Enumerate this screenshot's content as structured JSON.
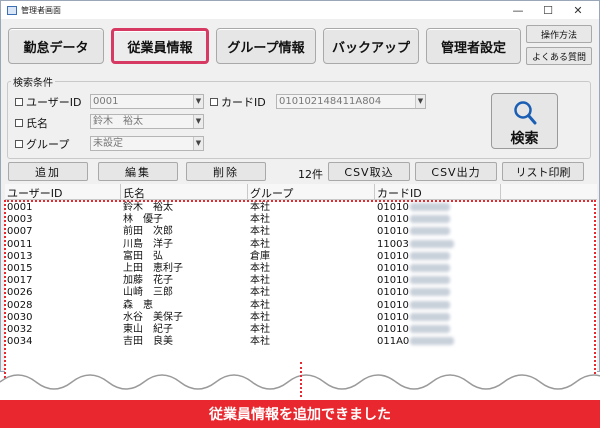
{
  "window": {
    "title": "管理者画面"
  },
  "controls": {
    "minimize": "—",
    "maximize": "☐",
    "close": "✕"
  },
  "nav": {
    "attendance": "勤怠データ",
    "employee": "従業員情報",
    "group": "グループ情報",
    "backup": "バックアップ",
    "admin": "管理者設定",
    "manual": "操作方法",
    "faq": "よくある質問"
  },
  "search": {
    "legend": "検索条件",
    "user_id_label": "ユーザーID",
    "user_id_value": "0001",
    "card_id_label": "カードID",
    "card_id_value": "010102148411A804",
    "name_label": "氏名",
    "name_value": "鈴木　裕太",
    "group_label": "グループ",
    "group_value": "未設定",
    "button": "検索"
  },
  "actions": {
    "add": "追加",
    "edit": "編集",
    "delete": "削除",
    "count": "12件",
    "csv_import": "CSV取込",
    "csv_export": "CSV出力",
    "list_print": "リスト印刷"
  },
  "table": {
    "headers": [
      "ユーザーID",
      "氏名",
      "グループ",
      "カードID"
    ],
    "rows": [
      {
        "id": "0001",
        "name": "鈴木　裕太",
        "group": "本社",
        "card": "01010"
      },
      {
        "id": "0003",
        "name": "林　優子",
        "group": "本社",
        "card": "01010"
      },
      {
        "id": "0007",
        "name": "前田　次郎",
        "group": "本社",
        "card": "01010"
      },
      {
        "id": "0011",
        "name": "川島　洋子",
        "group": "本社",
        "card": "11003"
      },
      {
        "id": "0013",
        "name": "富田　弘",
        "group": "倉庫",
        "card": "01010"
      },
      {
        "id": "0015",
        "name": "上田　恵利子",
        "group": "本社",
        "card": "01010"
      },
      {
        "id": "0017",
        "name": "加藤　花子",
        "group": "本社",
        "card": "01010"
      },
      {
        "id": "0026",
        "name": "山崎　三郎",
        "group": "本社",
        "card": "01010"
      },
      {
        "id": "0028",
        "name": "森　恵",
        "group": "本社",
        "card": "01010"
      },
      {
        "id": "0030",
        "name": "水谷　美保子",
        "group": "本社",
        "card": "01010"
      },
      {
        "id": "0032",
        "name": "東山　紀子",
        "group": "本社",
        "card": "01010"
      },
      {
        "id": "0034",
        "name": "吉田　良美",
        "group": "本社",
        "card": "011A0"
      }
    ]
  },
  "banner": "従業員情報を追加できました",
  "colors": {
    "accent_pink": "#d63a63",
    "highlight_red": "#e8282e"
  }
}
